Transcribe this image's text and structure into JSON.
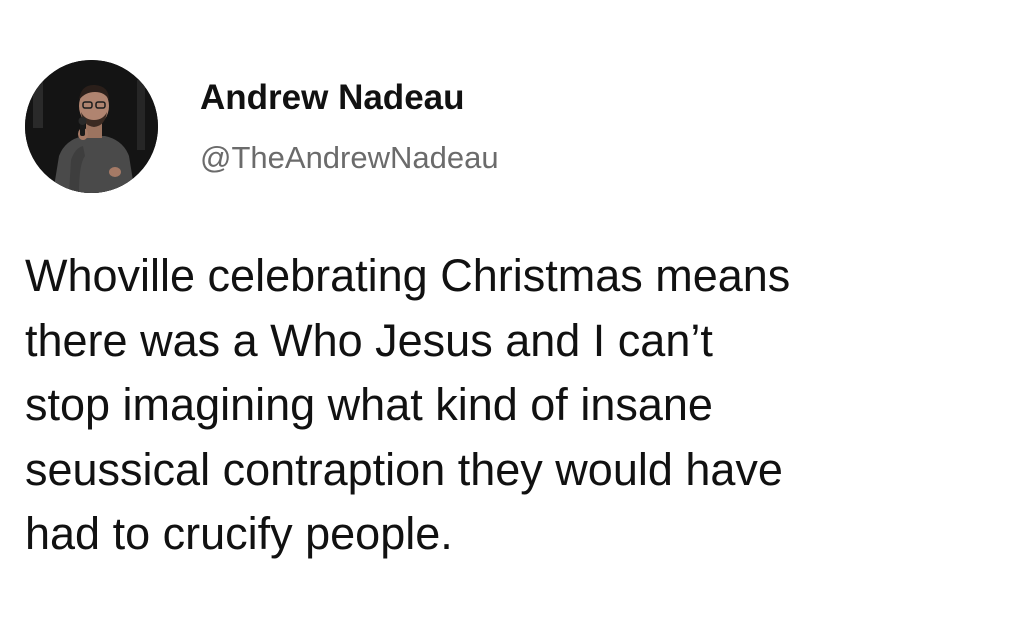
{
  "tweet": {
    "author": {
      "display_name": "Andrew Nadeau",
      "handle": "@TheAndrewNadeau",
      "avatar_icon": "avatar-photo"
    },
    "text_lines": [
      "Whoville celebrating Christmas means",
      "there was a Who Jesus and I can’t",
      "stop imagining what kind of insane",
      "seussical contraption they would have",
      "had to crucify people."
    ]
  }
}
